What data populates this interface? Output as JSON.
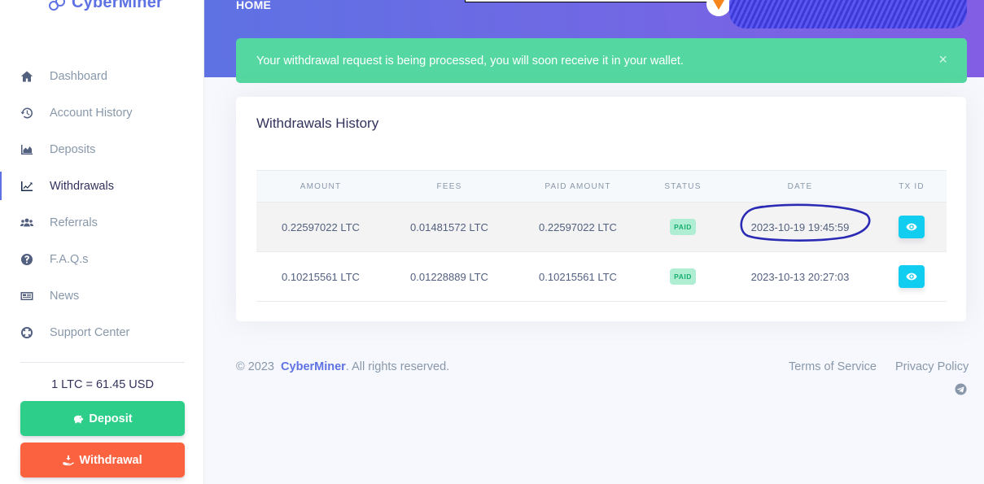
{
  "brand": {
    "name": "CyberMiner",
    "color": "#5e72e4"
  },
  "sidebar": {
    "items": [
      {
        "label": "Dashboard",
        "icon": "home-icon"
      },
      {
        "label": "Account History",
        "icon": "history-icon"
      },
      {
        "label": "Deposits",
        "icon": "area-chart-icon"
      },
      {
        "label": "Withdrawals",
        "icon": "line-chart-icon",
        "active": true
      },
      {
        "label": "Referrals",
        "icon": "users-icon"
      },
      {
        "label": "F.A.Q.s",
        "icon": "question-circle-icon"
      },
      {
        "label": "News",
        "icon": "newspaper-icon"
      },
      {
        "label": "Support Center",
        "icon": "lifebuoy-icon"
      }
    ],
    "rate": "1 LTC = 61.45 USD",
    "deposit_label": "Deposit",
    "withdrawal_label": "Withdrawal"
  },
  "header": {
    "title": "HOME"
  },
  "alert": {
    "message": "Your withdrawal request is being processed, you will soon receive it in your wallet.",
    "close": "×",
    "color": "#54d7a0"
  },
  "card": {
    "title": "Withdrawals History",
    "columns": [
      "AMOUNT",
      "FEES",
      "PAID AMOUNT",
      "STATUS",
      "DATE",
      "TX ID"
    ],
    "rows": [
      {
        "amount": "0.22597022 LTC",
        "fees": "0.01481572 LTC",
        "paid": "0.22597022 LTC",
        "status": "PAID",
        "date": "2023-10-19 19:45:59"
      },
      {
        "amount": "0.10215561 LTC",
        "fees": "0.01228889 LTC",
        "paid": "0.10215561 LTC",
        "status": "PAID",
        "date": "2023-10-13 20:27:03"
      }
    ]
  },
  "footer": {
    "copyright_prefix": "© 2023",
    "brand": "CyberMiner",
    "copyright_suffix": ". All rights reserved.",
    "terms": "Terms of Service",
    "privacy": "Privacy Policy"
  },
  "colors": {
    "success": "#2dce89",
    "warning": "#fb6340",
    "info": "#11cdef",
    "muted": "#8898aa"
  }
}
